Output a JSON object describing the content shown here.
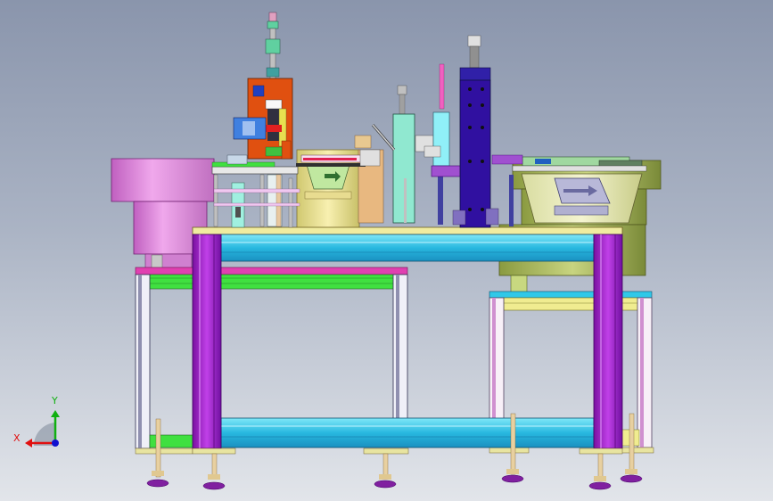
{
  "viewport": {
    "background_top": "#8a95ac",
    "background_bottom": "#e2e5ea"
  },
  "triad": {
    "x_label": "X",
    "y_label": "Y",
    "x_color": "#e01010",
    "y_color": "#10b010",
    "z_color": "#1010d0"
  },
  "colors": {
    "frame_purple": "#a020d0",
    "rail_cyan": "#30c8e8",
    "rail_green": "#40e040",
    "rail_magenta": "#e040b0",
    "table_top": "#f0eca0",
    "bowl_pink": "#e890e0",
    "bowl_olive": "#a8b860",
    "tower_navy": "#3010a0",
    "cylinder_orange": "#e05010",
    "foot_purple": "#8020a0"
  }
}
